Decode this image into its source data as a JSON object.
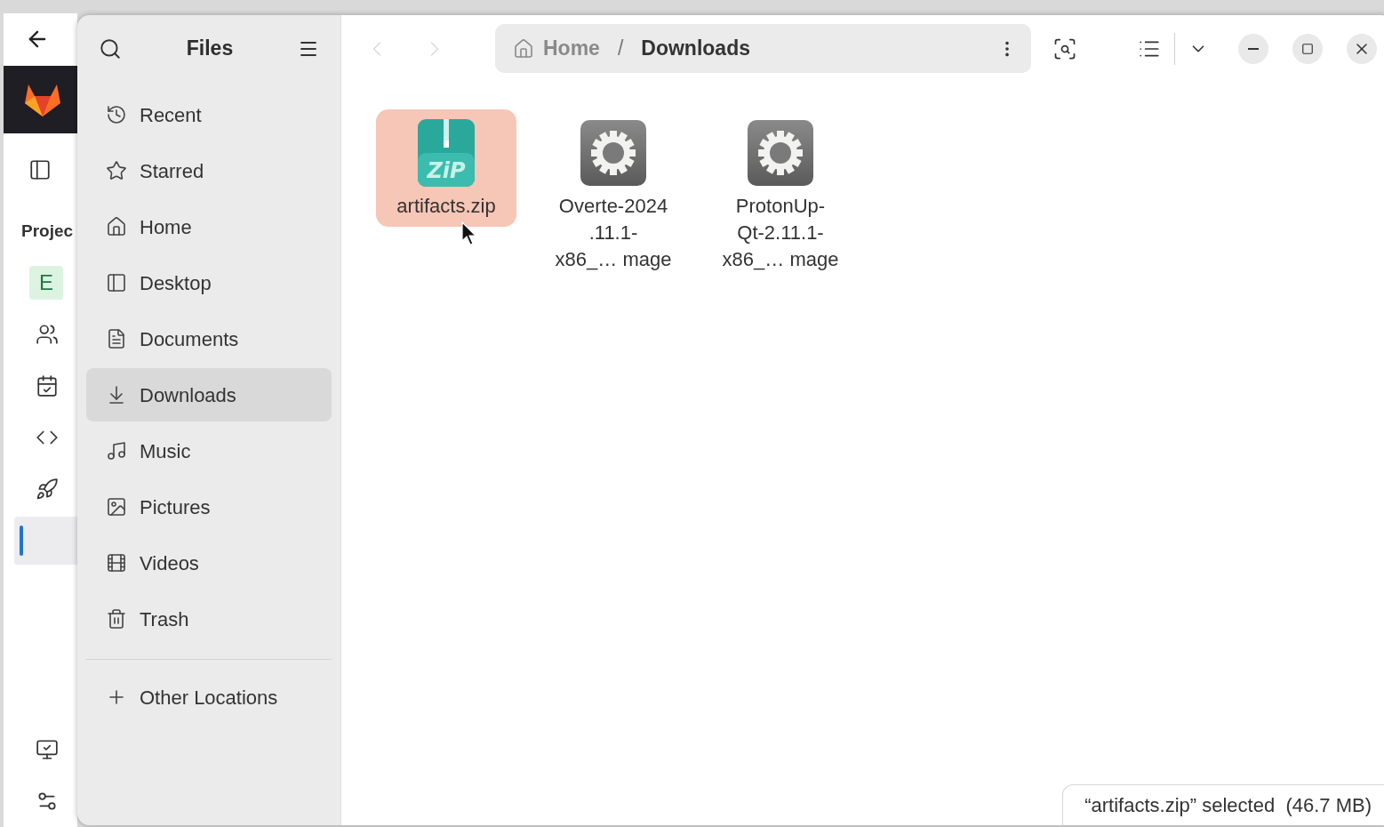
{
  "background_app": {
    "section_title": "Projec",
    "nav_items": [
      {
        "kind": "badge",
        "badge": "E",
        "selected": false
      },
      {
        "kind": "people",
        "selected": false
      },
      {
        "kind": "calendar",
        "selected": false
      },
      {
        "kind": "code",
        "selected": false
      },
      {
        "kind": "rocket",
        "selected": false
      },
      {
        "kind": "plain",
        "selected": true
      },
      {
        "kind": "deploy",
        "selected": false
      },
      {
        "kind": "ops",
        "selected": false
      }
    ]
  },
  "files_window": {
    "title": "Files",
    "sidebar": {
      "places": [
        {
          "kind": "recent",
          "label": "Recent",
          "selected": false
        },
        {
          "kind": "starred",
          "label": "Starred",
          "selected": false
        },
        {
          "kind": "home",
          "label": "Home",
          "selected": false
        },
        {
          "kind": "desktop",
          "label": "Desktop",
          "selected": false
        },
        {
          "kind": "documents",
          "label": "Documents",
          "selected": false
        },
        {
          "kind": "downloads",
          "label": "Downloads",
          "selected": true
        },
        {
          "kind": "music",
          "label": "Music",
          "selected": false
        },
        {
          "kind": "pictures",
          "label": "Pictures",
          "selected": false
        },
        {
          "kind": "videos",
          "label": "Videos",
          "selected": false
        },
        {
          "kind": "trash",
          "label": "Trash",
          "selected": false
        }
      ],
      "other": {
        "label": "Other Locations"
      }
    },
    "nav": {
      "back_disabled": true,
      "forward_disabled": true
    },
    "path": [
      {
        "kind": "home",
        "label": "Home",
        "current": false
      },
      {
        "kind": "folder",
        "label": "Downloads",
        "current": true
      }
    ],
    "path_separator": "/",
    "files": [
      {
        "kind": "archive",
        "icon_text": "ZiP",
        "name_lines": [
          "artifacts.zip"
        ],
        "selected": true
      },
      {
        "kind": "executable",
        "name_lines": [
          "Overte-2024",
          ".11.1-",
          "x86_… mage"
        ],
        "selected": false
      },
      {
        "kind": "executable",
        "name_lines": [
          "ProtonUp-",
          "Qt-2.11.1-",
          "x86_… mage"
        ],
        "selected": false
      }
    ],
    "status": "“artifacts.zip” selected  (46.7 MB)"
  }
}
